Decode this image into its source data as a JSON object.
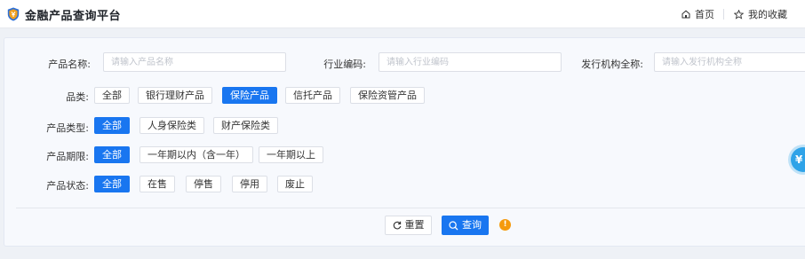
{
  "header": {
    "title": "金融产品查询平台",
    "nav": {
      "home_label": "首页",
      "favorites_label": "我的收藏"
    }
  },
  "form": {
    "product_name": {
      "label": "产品名称:",
      "placeholder": "请输入产品名称"
    },
    "industry_code": {
      "label": "行业编码:",
      "placeholder": "请输入行业编码"
    },
    "issuer_name": {
      "label": "发行机构全称:",
      "placeholder": "请输入发行机构全称"
    }
  },
  "filters": {
    "category": {
      "label": "品类:",
      "options": [
        "全部",
        "银行理财产品",
        "保险产品",
        "信托产品",
        "保险资管产品"
      ],
      "selected": "保险产品"
    },
    "product_type": {
      "label": "产品类型:",
      "options": [
        "全部",
        "人身保险类",
        "财产保险类"
      ],
      "selected": "全部"
    },
    "term": {
      "label": "产品期限:",
      "options": [
        "全部",
        "一年期以内（含一年）",
        "一年期以上"
      ],
      "selected": "全部"
    },
    "status": {
      "label": "产品状态:",
      "options": [
        "全部",
        "在售",
        "停售",
        "停用",
        "废止"
      ],
      "selected": "全部"
    }
  },
  "actions": {
    "reset_label": "重置",
    "search_label": "查询",
    "warning_glyph": "!"
  },
  "floating": {
    "glyph": "¥"
  },
  "colors": {
    "primary": "#1976f0",
    "warning": "#f59a0d",
    "float": "#2fa3e8"
  }
}
